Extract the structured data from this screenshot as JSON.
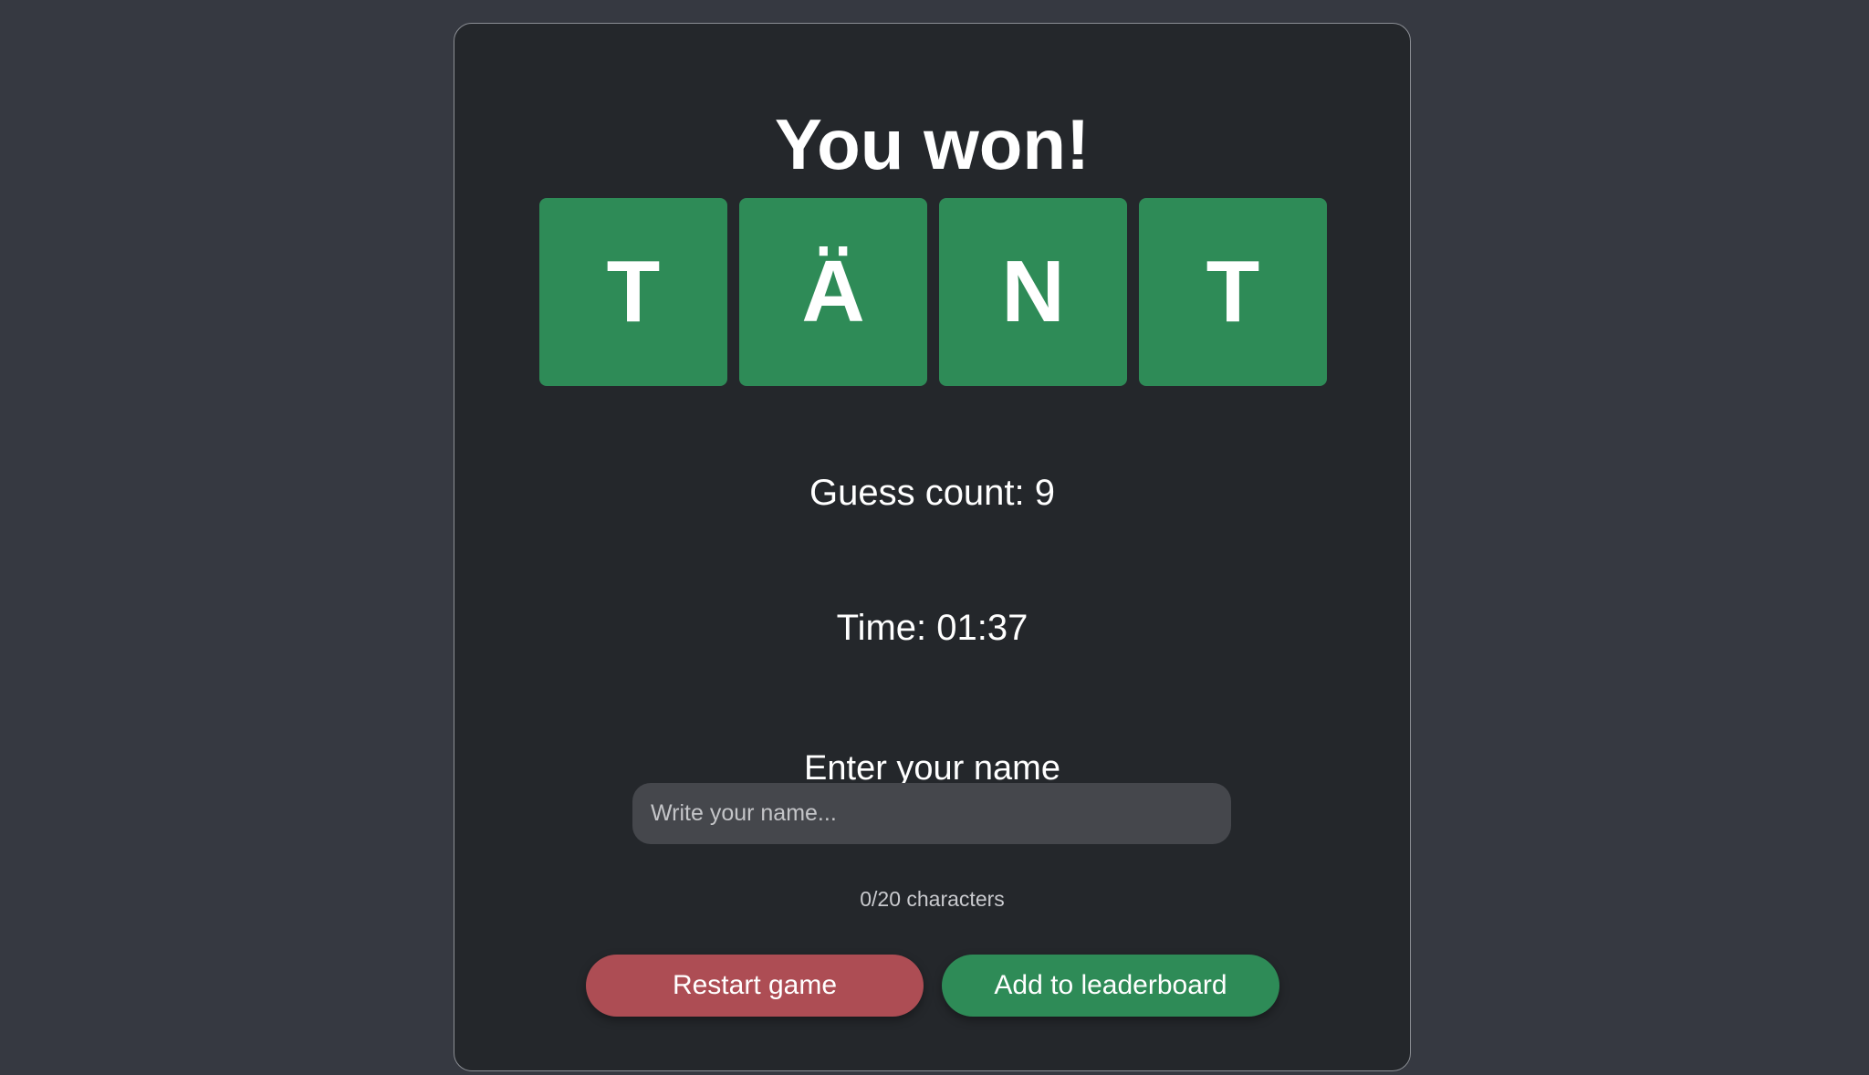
{
  "result": {
    "title": "You won!"
  },
  "word": {
    "tiles": [
      "T",
      "Ä",
      "N",
      "T"
    ],
    "tile_color": "#2e8b57"
  },
  "stats": {
    "guess_count": "Guess count: 9",
    "time": "Time: 01:37"
  },
  "name_entry": {
    "label": "Enter your name",
    "placeholder": "Write your name...",
    "value": "",
    "char_count": "0/20 characters"
  },
  "actions": {
    "restart_label": "Restart game",
    "restart_color": "#ad4d54",
    "leaderboard_label": "Add to leaderboard",
    "leaderboard_color": "#2e8b57"
  }
}
